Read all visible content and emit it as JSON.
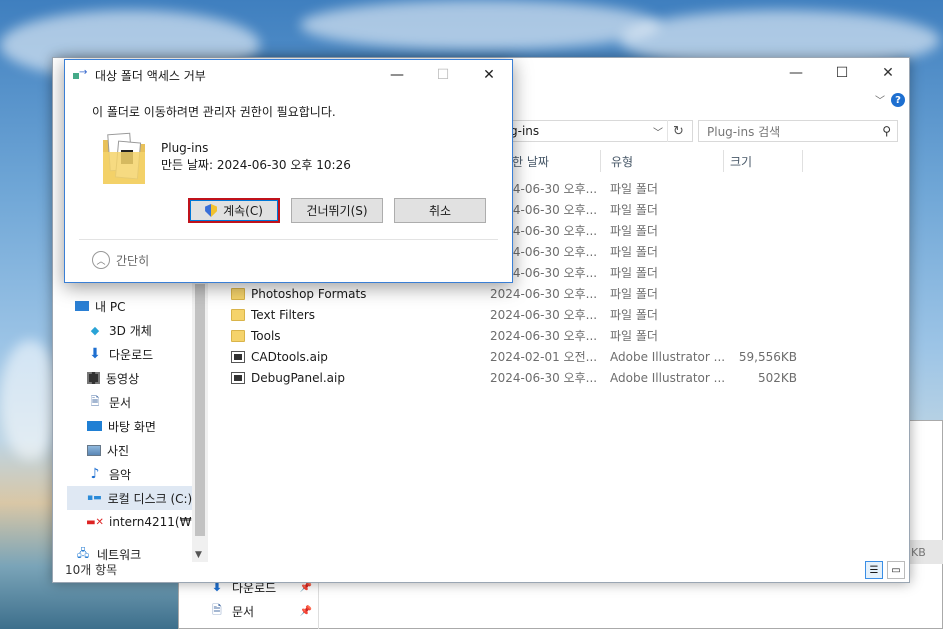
{
  "dialog": {
    "title": "대상 폴더 액세스 거부",
    "message": "이 폴더로 이동하려면 관리자 권한이 필요합니다.",
    "folder_name": "Plug-ins",
    "folder_date": "만든 날짜: 2024-06-30 오후 10:26",
    "continue_label": "계속(C)",
    "skip_label": "건너뛰기(S)",
    "cancel_label": "취소",
    "less_label": "간단히",
    "minimize": "—",
    "maximize": "☐",
    "close": "✕"
  },
  "explorer": {
    "minimize": "—",
    "maximize": "☐",
    "close": "✕",
    "address": "g-ins",
    "search_placeholder": "Plug-ins 검색",
    "columns": {
      "date": "한 날짜",
      "type": "유형",
      "size": "크기"
    },
    "files": [
      {
        "name": "",
        "date": "2024-06-30 오후...",
        "type": "파일 폴더",
        "size": ""
      },
      {
        "name": "",
        "date": "2024-06-30 오후...",
        "type": "파일 폴더",
        "size": ""
      },
      {
        "name": "",
        "date": "2024-06-30 오후...",
        "type": "파일 폴더",
        "size": ""
      },
      {
        "name": "",
        "date": "2024-06-30 오후...",
        "type": "파일 폴더",
        "size": ""
      },
      {
        "name": "",
        "date": "2024-06-30 오후...",
        "type": "파일 폴더",
        "size": ""
      },
      {
        "name": "Photoshop Formats",
        "date": "2024-06-30 오후...",
        "type": "파일 폴더",
        "size": ""
      },
      {
        "name": "Text Filters",
        "date": "2024-06-30 오후...",
        "type": "파일 폴더",
        "size": ""
      },
      {
        "name": "Tools",
        "date": "2024-06-30 오후...",
        "type": "파일 폴더",
        "size": ""
      },
      {
        "name": "CADtools.aip",
        "date": "2024-02-01 오전...",
        "type": "Adobe Illustrator ...",
        "size": "59,556KB"
      },
      {
        "name": "DebugPanel.aip",
        "date": "2024-06-30 오후...",
        "type": "Adobe Illustrator ...",
        "size": "502KB"
      }
    ],
    "nav": [
      {
        "label": "내 PC",
        "icon": "pc-icon"
      },
      {
        "label": "3D 개체",
        "icon": "cube-icon"
      },
      {
        "label": "다운로드",
        "icon": "download-icon"
      },
      {
        "label": "동영상",
        "icon": "video-icon"
      },
      {
        "label": "문서",
        "icon": "document-icon"
      },
      {
        "label": "바탕 화면",
        "icon": "desktop-icon"
      },
      {
        "label": "사진",
        "icon": "picture-icon"
      },
      {
        "label": "음악",
        "icon": "music-icon"
      },
      {
        "label": "로컬 디스크 (C:)",
        "icon": "disk-icon"
      },
      {
        "label": "intern4211(₩₩i",
        "icon": "network-drive-icon"
      },
      {
        "label": "네트워크",
        "icon": "network-icon"
      }
    ],
    "status": "10개 항목"
  },
  "background_window": {
    "nav": [
      {
        "label": "다운로드",
        "icon": "download-icon"
      },
      {
        "label": "문서",
        "icon": "document-icon"
      }
    ],
    "size_fragment": "KB"
  }
}
